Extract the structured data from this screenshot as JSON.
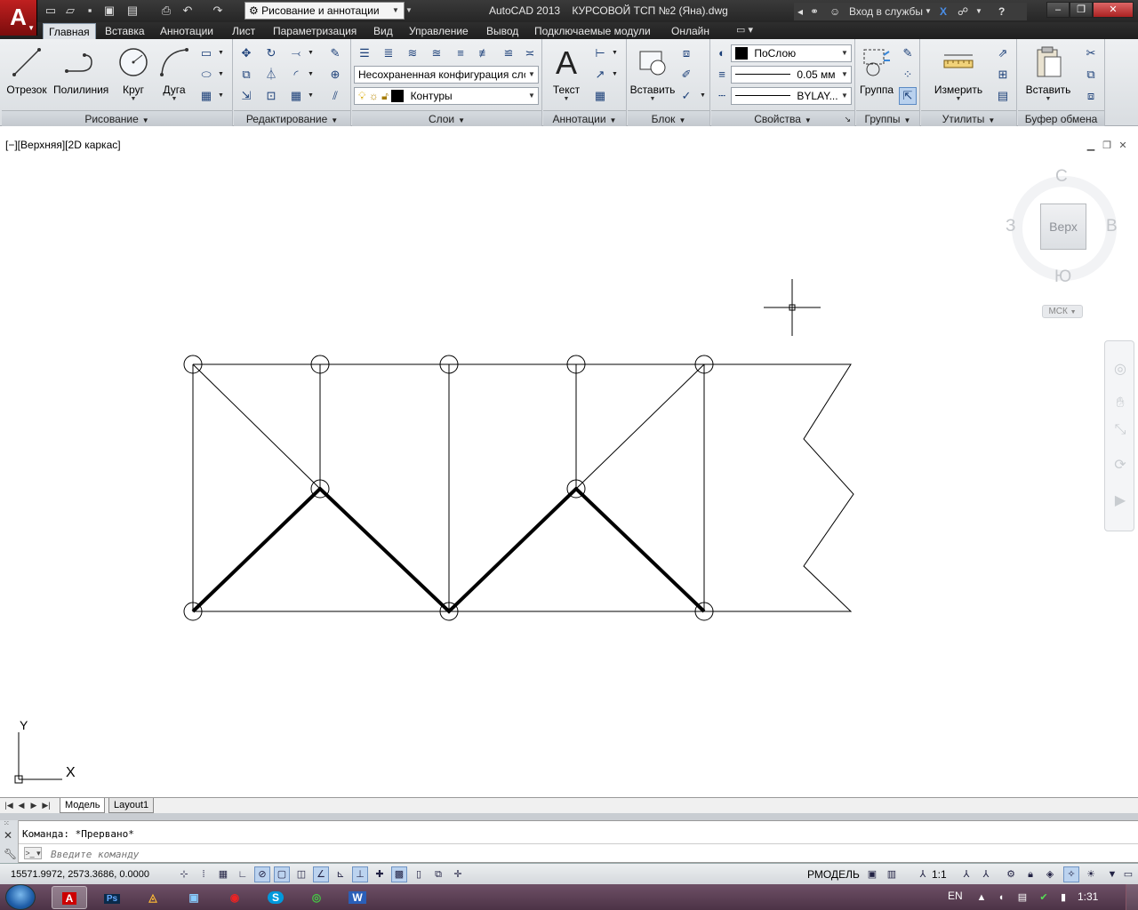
{
  "app": {
    "title": "AutoCAD 2013    КУРСОВОЙ ТСП №2 (Яна).dwg",
    "logo_letter": "A",
    "workspace": "Рисование и аннотации",
    "signin": "Вход в службы",
    "help": "?"
  },
  "quick_access": {
    "icons": [
      "new-icon",
      "open-icon",
      "save-icon",
      "saveas-icon",
      "plot-preview-icon",
      "print-icon",
      "undo-icon",
      "redo-icon"
    ]
  },
  "tabs": [
    "Главная",
    "Вставка",
    "Аннотации",
    "Лист",
    "Параметризация",
    "Вид",
    "Управление",
    "Вывод",
    "Подключаемые модули",
    "Онлайн"
  ],
  "active_tab": "Главная",
  "ribbon": {
    "draw": {
      "title": "Рисование",
      "line": "Отрезок",
      "polyline": "Полилиния",
      "circle": "Круг",
      "arc": "Дуга"
    },
    "modify": {
      "title": "Редактирование"
    },
    "layers": {
      "title": "Слои",
      "layer_state": "Несохраненная конфигурация сло",
      "current_layer": "Контуры"
    },
    "annotation": {
      "title": "Аннотации",
      "text": "Текст"
    },
    "block": {
      "title": "Блок",
      "insert": "Вставить"
    },
    "properties": {
      "title": "Свойства",
      "color": "ПоСлою",
      "lineweight": "0.05 мм",
      "linetype": "BYLAY..."
    },
    "groups": {
      "title": "Группы",
      "group": "Группа"
    },
    "utilities": {
      "title": "Утилиты",
      "measure": "Измерить"
    },
    "clipboard": {
      "title": "Буфер обмена",
      "paste": "Вставить"
    }
  },
  "viewport": {
    "label": "[−][Верхняя][2D каркас]",
    "viewcube": {
      "north": "С",
      "south": "Ю",
      "west": "З",
      "east": "В",
      "face": "Верх",
      "ucs": "МСК"
    },
    "ucs_icon": {
      "x": "X",
      "y": "Y"
    }
  },
  "layout_tabs": [
    "Модель",
    "Layout1"
  ],
  "command": {
    "history": "Команда:  *Прервано*",
    "placeholder": "Введите команду"
  },
  "status": {
    "coords": "15571.9972, 2573.3686, 0.0000",
    "model": "РМОДЕЛЬ",
    "scale": "1:1"
  },
  "taskbar": {
    "apps": [
      "autocad",
      "photoshop",
      "archicad",
      "save-app",
      "opera",
      "skype",
      "chrome",
      "word"
    ],
    "language": "EN",
    "clock": "1:31"
  }
}
